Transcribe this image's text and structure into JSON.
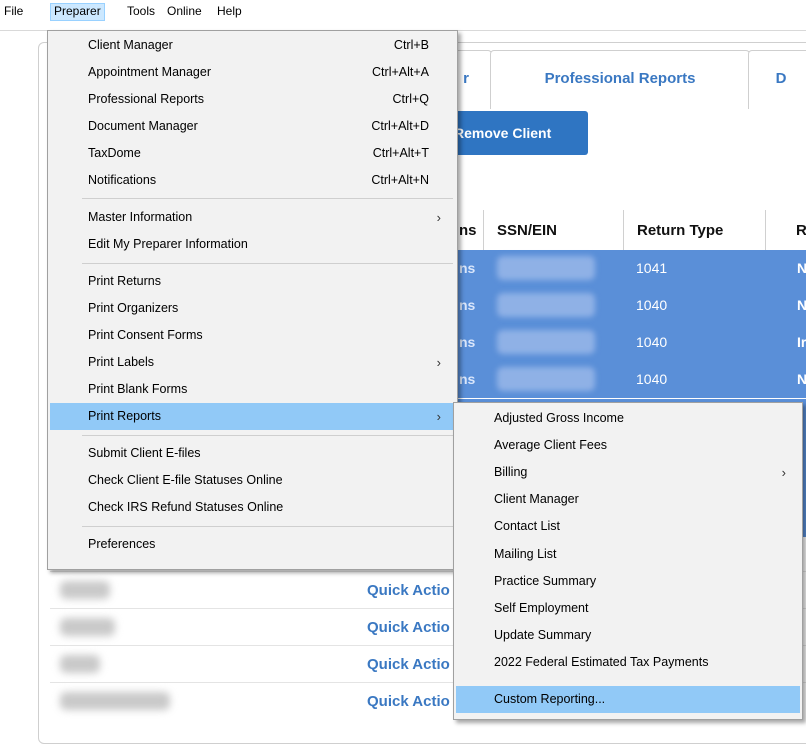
{
  "menubar": {
    "items": [
      "File",
      "Preparer",
      "Tools",
      "Online",
      "Help"
    ]
  },
  "background": {
    "tabs": [
      "r",
      "Professional Reports",
      "D"
    ],
    "remove_client_label": "Remove Client",
    "columns": [
      "ns",
      "SSN/EIN",
      "Return Type",
      "R"
    ],
    "rows": [
      {
        "name_fragment": "ns",
        "return_type": "1041",
        "status_fragment": "N"
      },
      {
        "name_fragment": "ns",
        "return_type": "1040",
        "status_fragment": "N"
      },
      {
        "name_fragment": "ns",
        "return_type": "1040",
        "status_fragment": "Ir"
      },
      {
        "name_fragment": "ns",
        "return_type": "1040",
        "status_fragment": "N"
      }
    ],
    "quick_action_label": "Quick Actio",
    "quick_rows": 4
  },
  "preparer_menu": {
    "items": [
      {
        "label": "Client Manager",
        "shortcut": "Ctrl+B"
      },
      {
        "label": "Appointment Manager",
        "shortcut": "Ctrl+Alt+A"
      },
      {
        "label": "Professional Reports",
        "shortcut": "Ctrl+Q"
      },
      {
        "label": "Document Manager",
        "shortcut": "Ctrl+Alt+D"
      },
      {
        "label": "TaxDome",
        "shortcut": "Ctrl+Alt+T"
      },
      {
        "label": "Notifications",
        "shortcut": "Ctrl+Alt+N"
      },
      {
        "label": "Master Information",
        "submenu": true
      },
      {
        "label": "Edit My Preparer Information"
      },
      {
        "label": "Print Returns"
      },
      {
        "label": "Print Organizers"
      },
      {
        "label": "Print Consent Forms"
      },
      {
        "label": "Print Labels",
        "submenu": true
      },
      {
        "label": "Print Blank Forms"
      },
      {
        "label": "Print Reports",
        "submenu": true,
        "highlighted": true
      },
      {
        "label": "Submit Client E-files"
      },
      {
        "label": "Check Client E-file Statuses Online"
      },
      {
        "label": "Check IRS Refund Statuses Online"
      },
      {
        "label": "Preferences"
      }
    ]
  },
  "reports_submenu": {
    "items": [
      {
        "label": "Adjusted Gross Income"
      },
      {
        "label": "Average Client Fees"
      },
      {
        "label": "Billing",
        "submenu": true
      },
      {
        "label": "Client Manager"
      },
      {
        "label": "Contact List"
      },
      {
        "label": "Mailing List"
      },
      {
        "label": "Practice Summary"
      },
      {
        "label": "Self Employment"
      },
      {
        "label": "Update Summary"
      },
      {
        "label": "2022 Federal Estimated Tax Payments"
      },
      {
        "label": "Custom Reporting...",
        "highlighted": true
      }
    ]
  },
  "glyphs": {
    "submenu_arrow": "›"
  },
  "colors": {
    "accent": "#3a78c2",
    "selection": "#5a8fd8",
    "menu_highlight": "#91c9f7"
  }
}
